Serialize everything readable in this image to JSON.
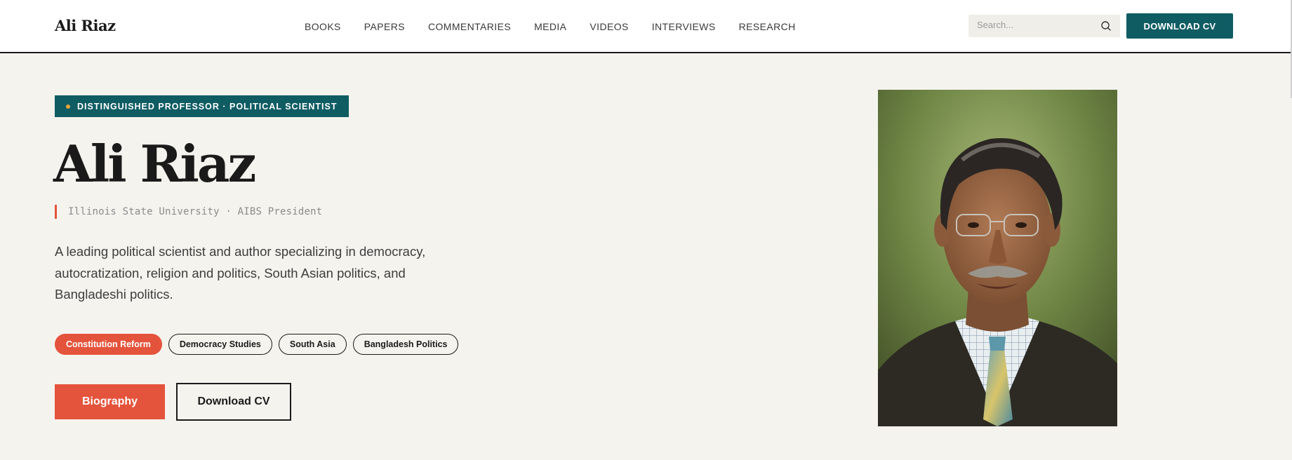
{
  "header": {
    "logo": "Ali Riaz",
    "nav": [
      "BOOKS",
      "PAPERS",
      "COMMENTARIES",
      "MEDIA",
      "VIDEOS",
      "INTERVIEWS",
      "RESEARCH"
    ],
    "search_placeholder": "Search...",
    "search_icon": "search-icon",
    "download_cv_label": "DOWNLOAD CV"
  },
  "hero": {
    "badge": "DISTINGUISHED PROFESSOR · POLITICAL SCIENTIST",
    "name": "Ali Riaz",
    "affiliation": "Illinois State University · AIBS President",
    "description": "A leading political scientist and author specializing in democracy, autocratization, religion and politics, South Asian politics, and Bangladeshi politics.",
    "tags": [
      {
        "label": "Constitution Reform",
        "active": true
      },
      {
        "label": "Democracy Studies",
        "active": false
      },
      {
        "label": "South Asia",
        "active": false
      },
      {
        "label": "Bangladesh Politics",
        "active": false
      }
    ],
    "biography_label": "Biography",
    "download_cv_label": "Download CV"
  },
  "colors": {
    "teal": "#0f5c63",
    "coral": "#e4533b",
    "background": "#f5f3ee",
    "badge_dot": "#e8a53a"
  }
}
